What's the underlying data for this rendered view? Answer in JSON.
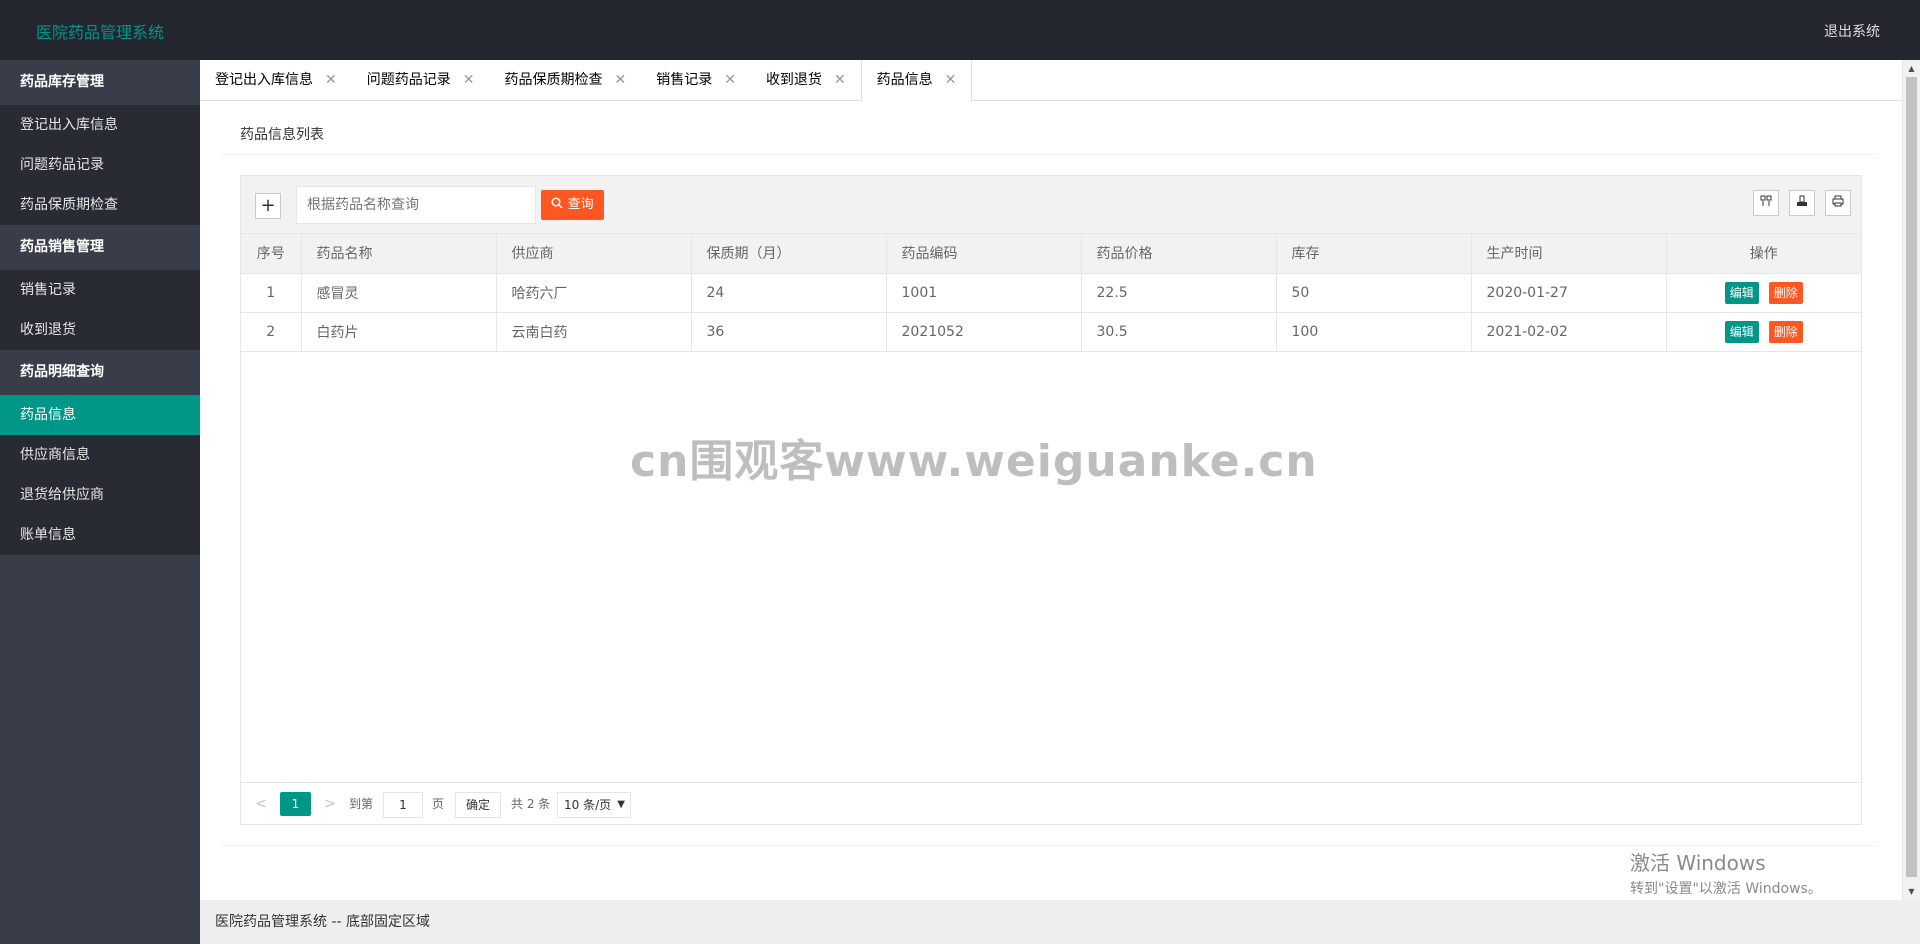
{
  "header": {
    "logo": "医院药品管理系统",
    "logout": "退出系统"
  },
  "sidebar": {
    "groups": [
      {
        "title": "药品库存管理",
        "items": [
          "登记出入库信息",
          "问题药品记录",
          "药品保质期检查"
        ]
      },
      {
        "title": "药品销售管理",
        "items": [
          "销售记录",
          "收到退货"
        ]
      },
      {
        "title": "药品明细查询",
        "items": [
          "药品信息",
          "供应商信息",
          "退货给供应商",
          "账单信息"
        ]
      }
    ],
    "active_item": "药品信息"
  },
  "tabs": [
    {
      "label": "登记出入库信息"
    },
    {
      "label": "问题药品记录"
    },
    {
      "label": "药品保质期检查"
    },
    {
      "label": "销售记录"
    },
    {
      "label": "收到退货"
    },
    {
      "label": "药品信息",
      "active": true
    }
  ],
  "card": {
    "title": "药品信息列表"
  },
  "toolbar": {
    "add": "+",
    "search_placeholder": "根据药品名称查询",
    "search_button": "查询",
    "icons": [
      "columns-icon",
      "export-icon",
      "print-icon"
    ]
  },
  "table": {
    "columns": [
      "序号",
      "药品名称",
      "供应商",
      "保质期（月）",
      "药品编码",
      "药品价格",
      "库存",
      "生产时间",
      "操作"
    ],
    "rows": [
      {
        "no": "1",
        "name": "感冒灵",
        "supplier": "哈药六厂",
        "shelf": "24",
        "code": "1001",
        "price": "22.5",
        "stock": "50",
        "date": "2020-01-27"
      },
      {
        "no": "2",
        "name": "白药片",
        "supplier": "云南白药",
        "shelf": "36",
        "code": "2021052",
        "price": "30.5",
        "stock": "100",
        "date": "2021-02-02"
      }
    ],
    "edit_label": "编辑",
    "delete_label": "删除"
  },
  "pager": {
    "current": "1",
    "goto_prefix": "到第",
    "goto_value": "1",
    "page_suffix": "页",
    "confirm": "确定",
    "total": "共 2 条",
    "page_size": "10 条/页"
  },
  "watermark": "cn围观客www.weiguanke.cn",
  "windows_activation": {
    "title": "激活 Windows",
    "subtitle": "转到\"设置\"以激活 Windows。"
  },
  "footer": {
    "text": "医院药品管理系统 -- 底部固定区域"
  },
  "colors": {
    "header_bg": "#23262e",
    "sidebar_bg": "#393d49",
    "accent": "#009688",
    "danger": "#ff5722"
  }
}
